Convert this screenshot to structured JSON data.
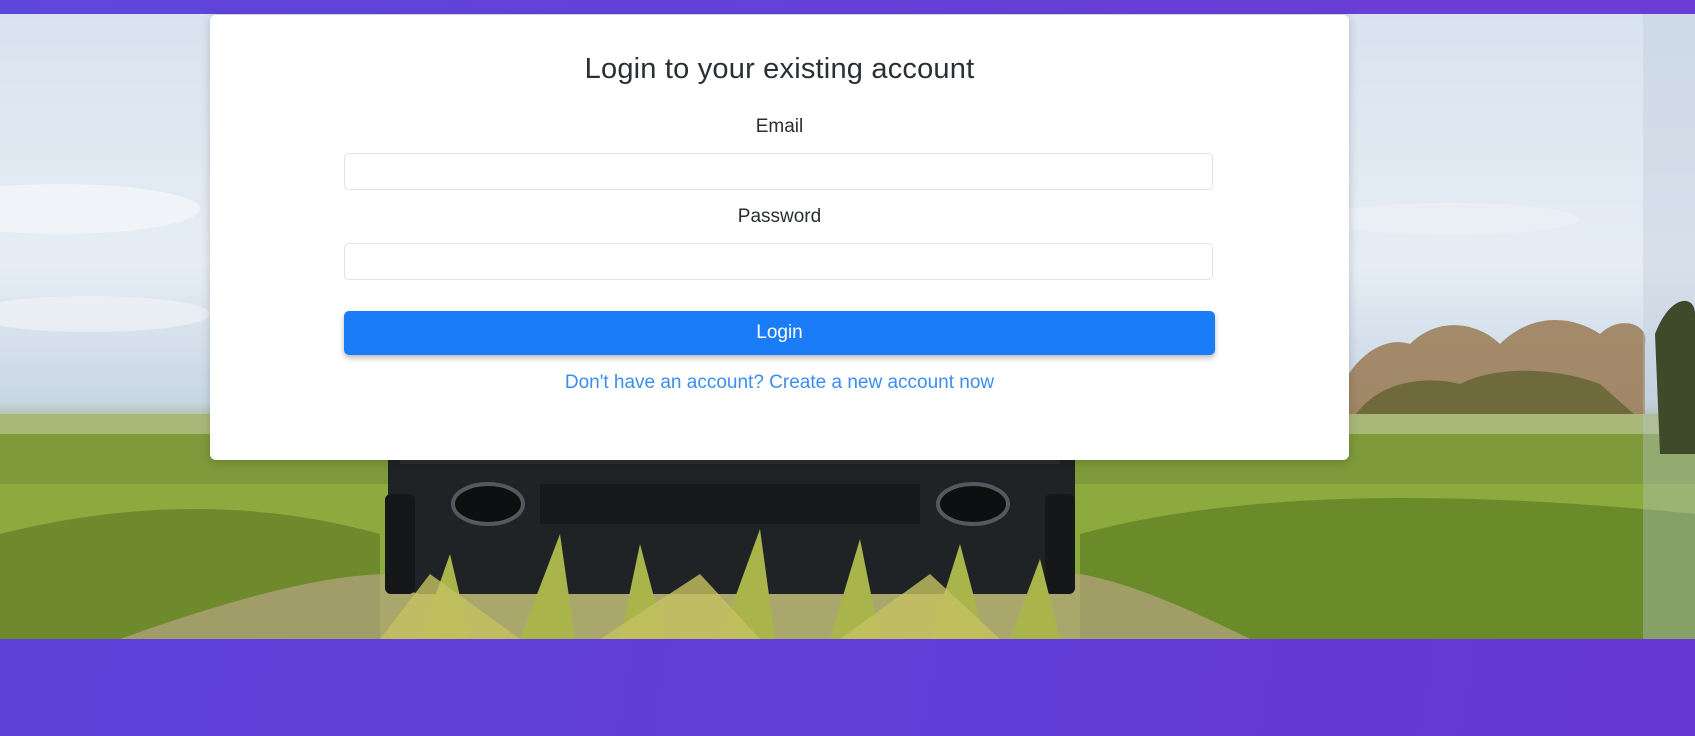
{
  "login_card": {
    "title": "Login to your existing account",
    "email_label": "Email",
    "email_value": "",
    "password_label": "Password",
    "password_value": "",
    "login_button_label": "Login",
    "signup_link_text": "Don't have an account? Create a new account now"
  },
  "colors": {
    "accent": "#1a7cf6",
    "link": "#3b8ef0",
    "background": "#6040d9"
  }
}
